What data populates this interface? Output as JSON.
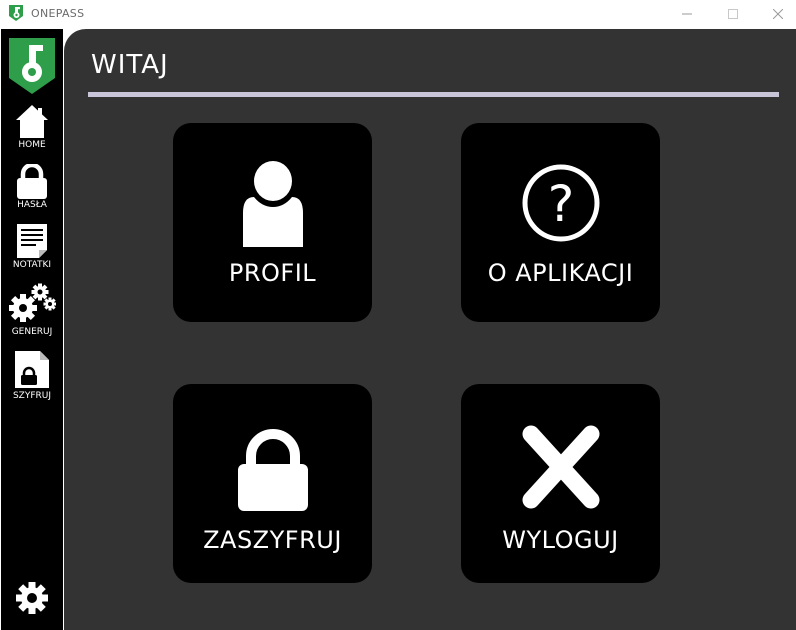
{
  "window": {
    "title": "ONEPASS",
    "controls": [
      "minimize",
      "maximize",
      "close"
    ]
  },
  "sidebar": {
    "logo_icon": "key-shield-logo",
    "items": [
      {
        "label": "HOME",
        "icon": "home-icon"
      },
      {
        "label": "HASŁA",
        "icon": "lock-icon"
      },
      {
        "label": "NOTATKI",
        "icon": "notes-icon"
      },
      {
        "label": "GENERUJ",
        "icon": "gears-icon"
      },
      {
        "label": "SZYFRUJ",
        "icon": "encrypt-file-icon"
      }
    ],
    "settings_icon": "gear-icon"
  },
  "main": {
    "title": "WITAJ",
    "tiles": [
      {
        "label": "PROFIL",
        "icon": "user-icon"
      },
      {
        "label": "O APLIKACJI",
        "icon": "question-icon"
      },
      {
        "label": "ZASZYFRUJ",
        "icon": "lock-icon"
      },
      {
        "label": "WYLOGUJ",
        "icon": "close-x-icon"
      }
    ]
  },
  "colors": {
    "brand_green": "#2e9e4a",
    "sidebar_bg": "#000000",
    "main_bg": "#333333",
    "tile_bg": "#000000",
    "title_rule": "#c9c6d9"
  }
}
